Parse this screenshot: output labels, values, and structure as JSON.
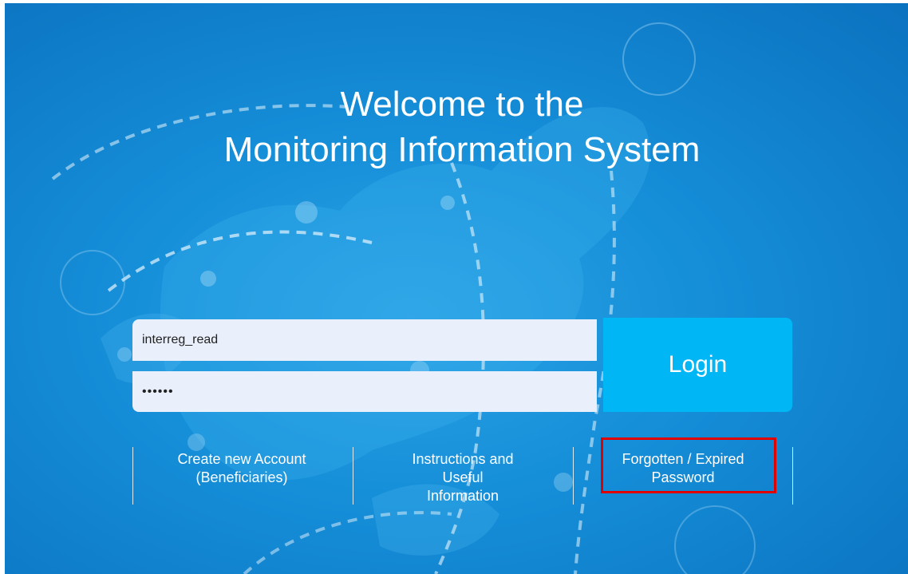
{
  "page": {
    "title_line1": "Welcome to the",
    "title_line2": "Monitoring Information System"
  },
  "login": {
    "username_value": "interreg_read",
    "password_value": "secret",
    "button_label": "Login"
  },
  "links": {
    "create_account": [
      "Create new Account",
      "(Beneficiaries)"
    ],
    "instructions": [
      "Instructions and",
      "Useful",
      "Information"
    ],
    "forgotten": [
      "Forgotten / Expired",
      "Password"
    ]
  },
  "colors": {
    "background": "#168fd9",
    "login_button": "#00b6f5",
    "input_background": "#e9effb",
    "highlight": "#e00000"
  }
}
